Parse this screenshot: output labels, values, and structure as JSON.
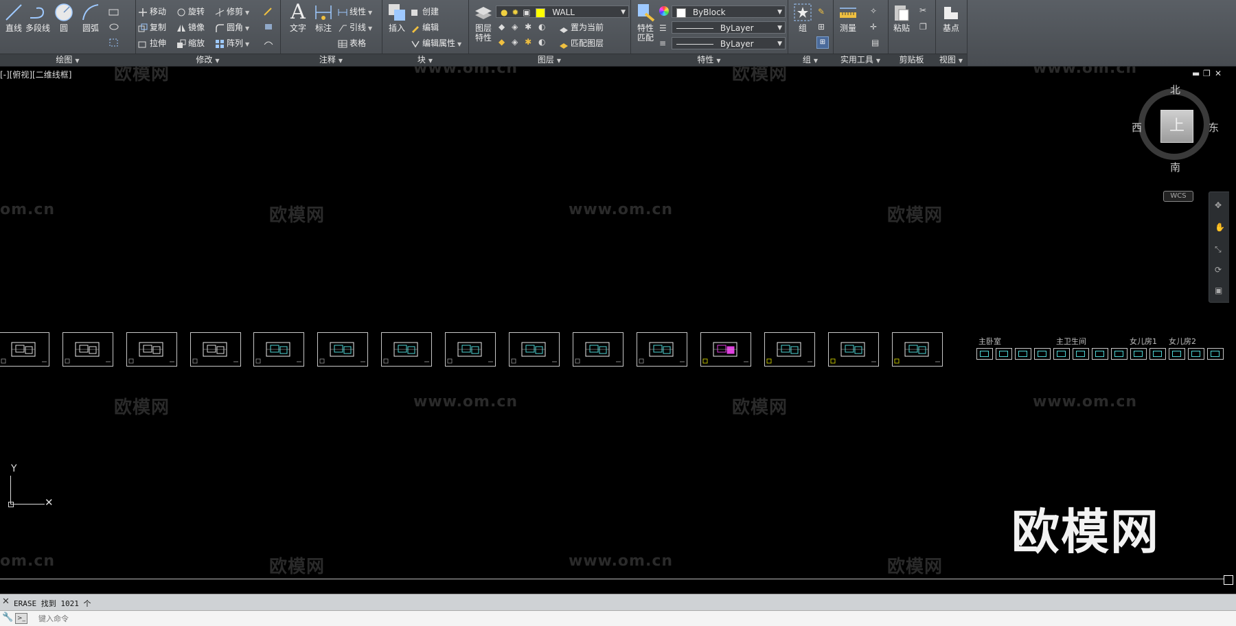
{
  "ribbon": {
    "draw": {
      "title": "绘图",
      "line": "直线",
      "polyline": "多段线",
      "circle": "圆",
      "arc": "圆弧"
    },
    "modify": {
      "title": "修改",
      "move": "移动",
      "rotate": "旋转",
      "trim": "修剪",
      "copy": "复制",
      "mirror": "镜像",
      "fillet": "圆角",
      "stretch": "拉伸",
      "scale": "缩放",
      "array": "阵列"
    },
    "annotation": {
      "title": "注释",
      "text": "文字",
      "dimension": "标注",
      "linear": "线性",
      "leader": "引线",
      "table": "表格"
    },
    "block": {
      "title": "块",
      "insert": "插入",
      "create": "创建",
      "edit": "编辑",
      "edit_attributes": "编辑属性"
    },
    "layers": {
      "title": "图层",
      "layer_props_1": "图层",
      "layer_props_2": "特性",
      "current_layer": "WALL",
      "current_layer_color": "#ffff00",
      "make_current": "置为当前",
      "match_layer": "匹配图层"
    },
    "properties": {
      "title": "特性",
      "match_1": "特性",
      "match_2": "匹配",
      "color": "ByBlock",
      "linetype": "ByLayer",
      "lineweight": "ByLayer"
    },
    "groups": {
      "title": "组",
      "group": "组"
    },
    "utilities": {
      "title": "实用工具",
      "measure": "测量"
    },
    "clipboard": {
      "title": "剪贴板",
      "paste": "粘贴"
    },
    "view": {
      "title": "视图",
      "base": "基点"
    }
  },
  "viewport": {
    "label": "[-][俯视][二维线框]",
    "viewcube": {
      "north": "北",
      "south": "南",
      "east": "东",
      "west": "西",
      "top": "上",
      "wcs": "WCS"
    },
    "axis_y": "Y",
    "sheet_groups": [
      "主卧室",
      "主卫生间",
      "女儿房1",
      "女儿房2"
    ],
    "watermarks": {
      "cn": "欧模网",
      "url": "www.om.cn",
      "partial_url": "om.cn",
      "big": "欧模网"
    },
    "colors": {
      "accent_cyan": "#4fd6d6",
      "accent_magenta": "#e040e0",
      "accent_yellow": "#e6e600"
    }
  },
  "command": {
    "history": "ERASE 找到 1021 个",
    "placeholder": "键入命令"
  }
}
